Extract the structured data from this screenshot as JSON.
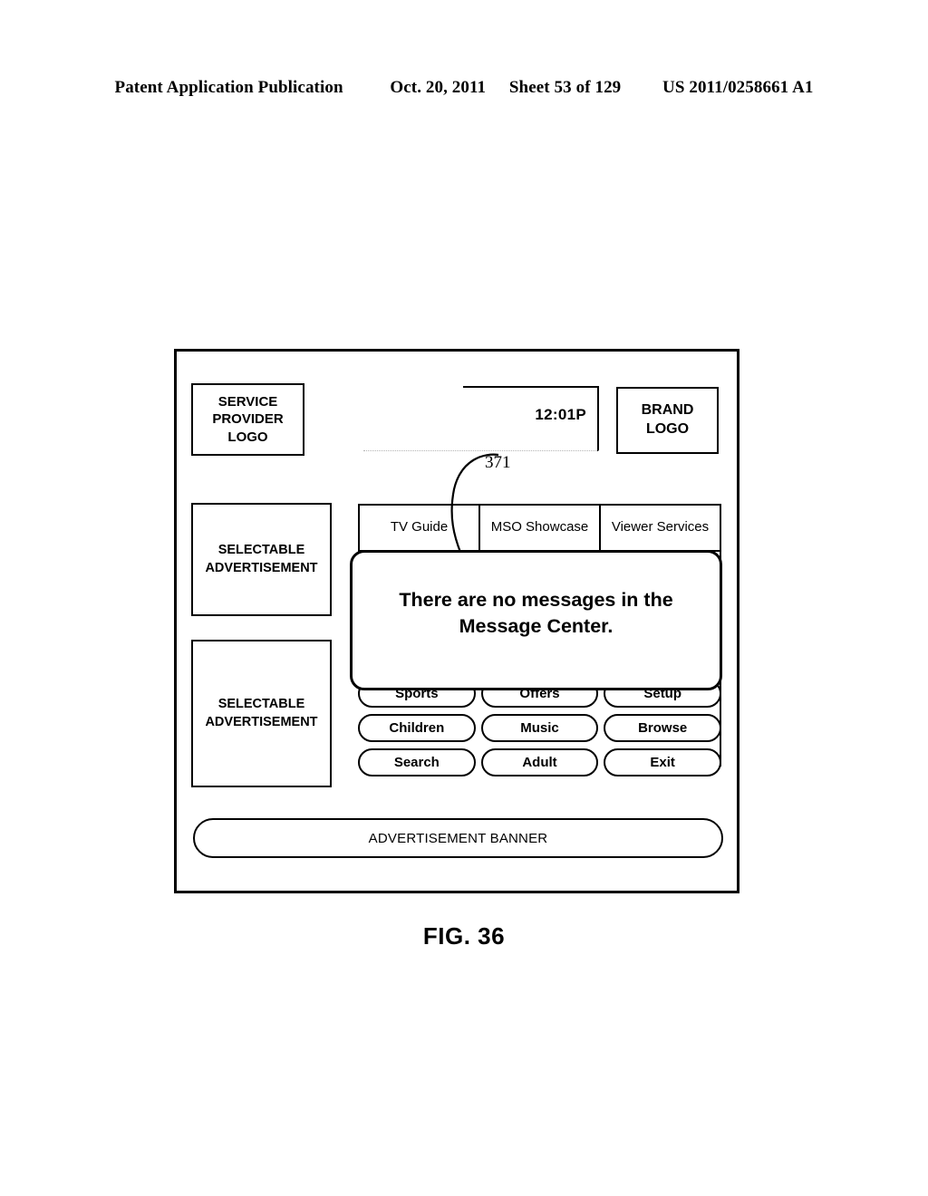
{
  "page_header": {
    "publication": "Patent Application Publication",
    "date": "Oct. 20, 2011",
    "sheet": "Sheet 53 of 129",
    "patent_number": "US 2011/0258661 A1"
  },
  "figure": {
    "caption": "FIG. 36",
    "reference_numeral": "371"
  },
  "screen": {
    "service_provider_logo": "SERVICE PROVIDER LOGO",
    "brand_logo": "BRAND LOGO",
    "clock": "12:01P",
    "advertisements": [
      {
        "label": "SELECTABLE ADVERTISEMENT"
      },
      {
        "label": "SELECTABLE ADVERTISEMENT"
      }
    ],
    "tabs": [
      {
        "label": "TV Guide"
      },
      {
        "label": "MSO Showcase"
      },
      {
        "label": "Viewer Services"
      }
    ],
    "buttons": [
      [
        {
          "label": "Sports"
        },
        {
          "label": "Offers"
        },
        {
          "label": "Setup"
        }
      ],
      [
        {
          "label": "Children"
        },
        {
          "label": "Music"
        },
        {
          "label": "Browse"
        }
      ],
      [
        {
          "label": "Search"
        },
        {
          "label": "Adult"
        },
        {
          "label": "Exit"
        }
      ]
    ],
    "banner": "ADVERTISEMENT BANNER",
    "dialog": {
      "message": "There are no messages in the Message Center."
    }
  }
}
